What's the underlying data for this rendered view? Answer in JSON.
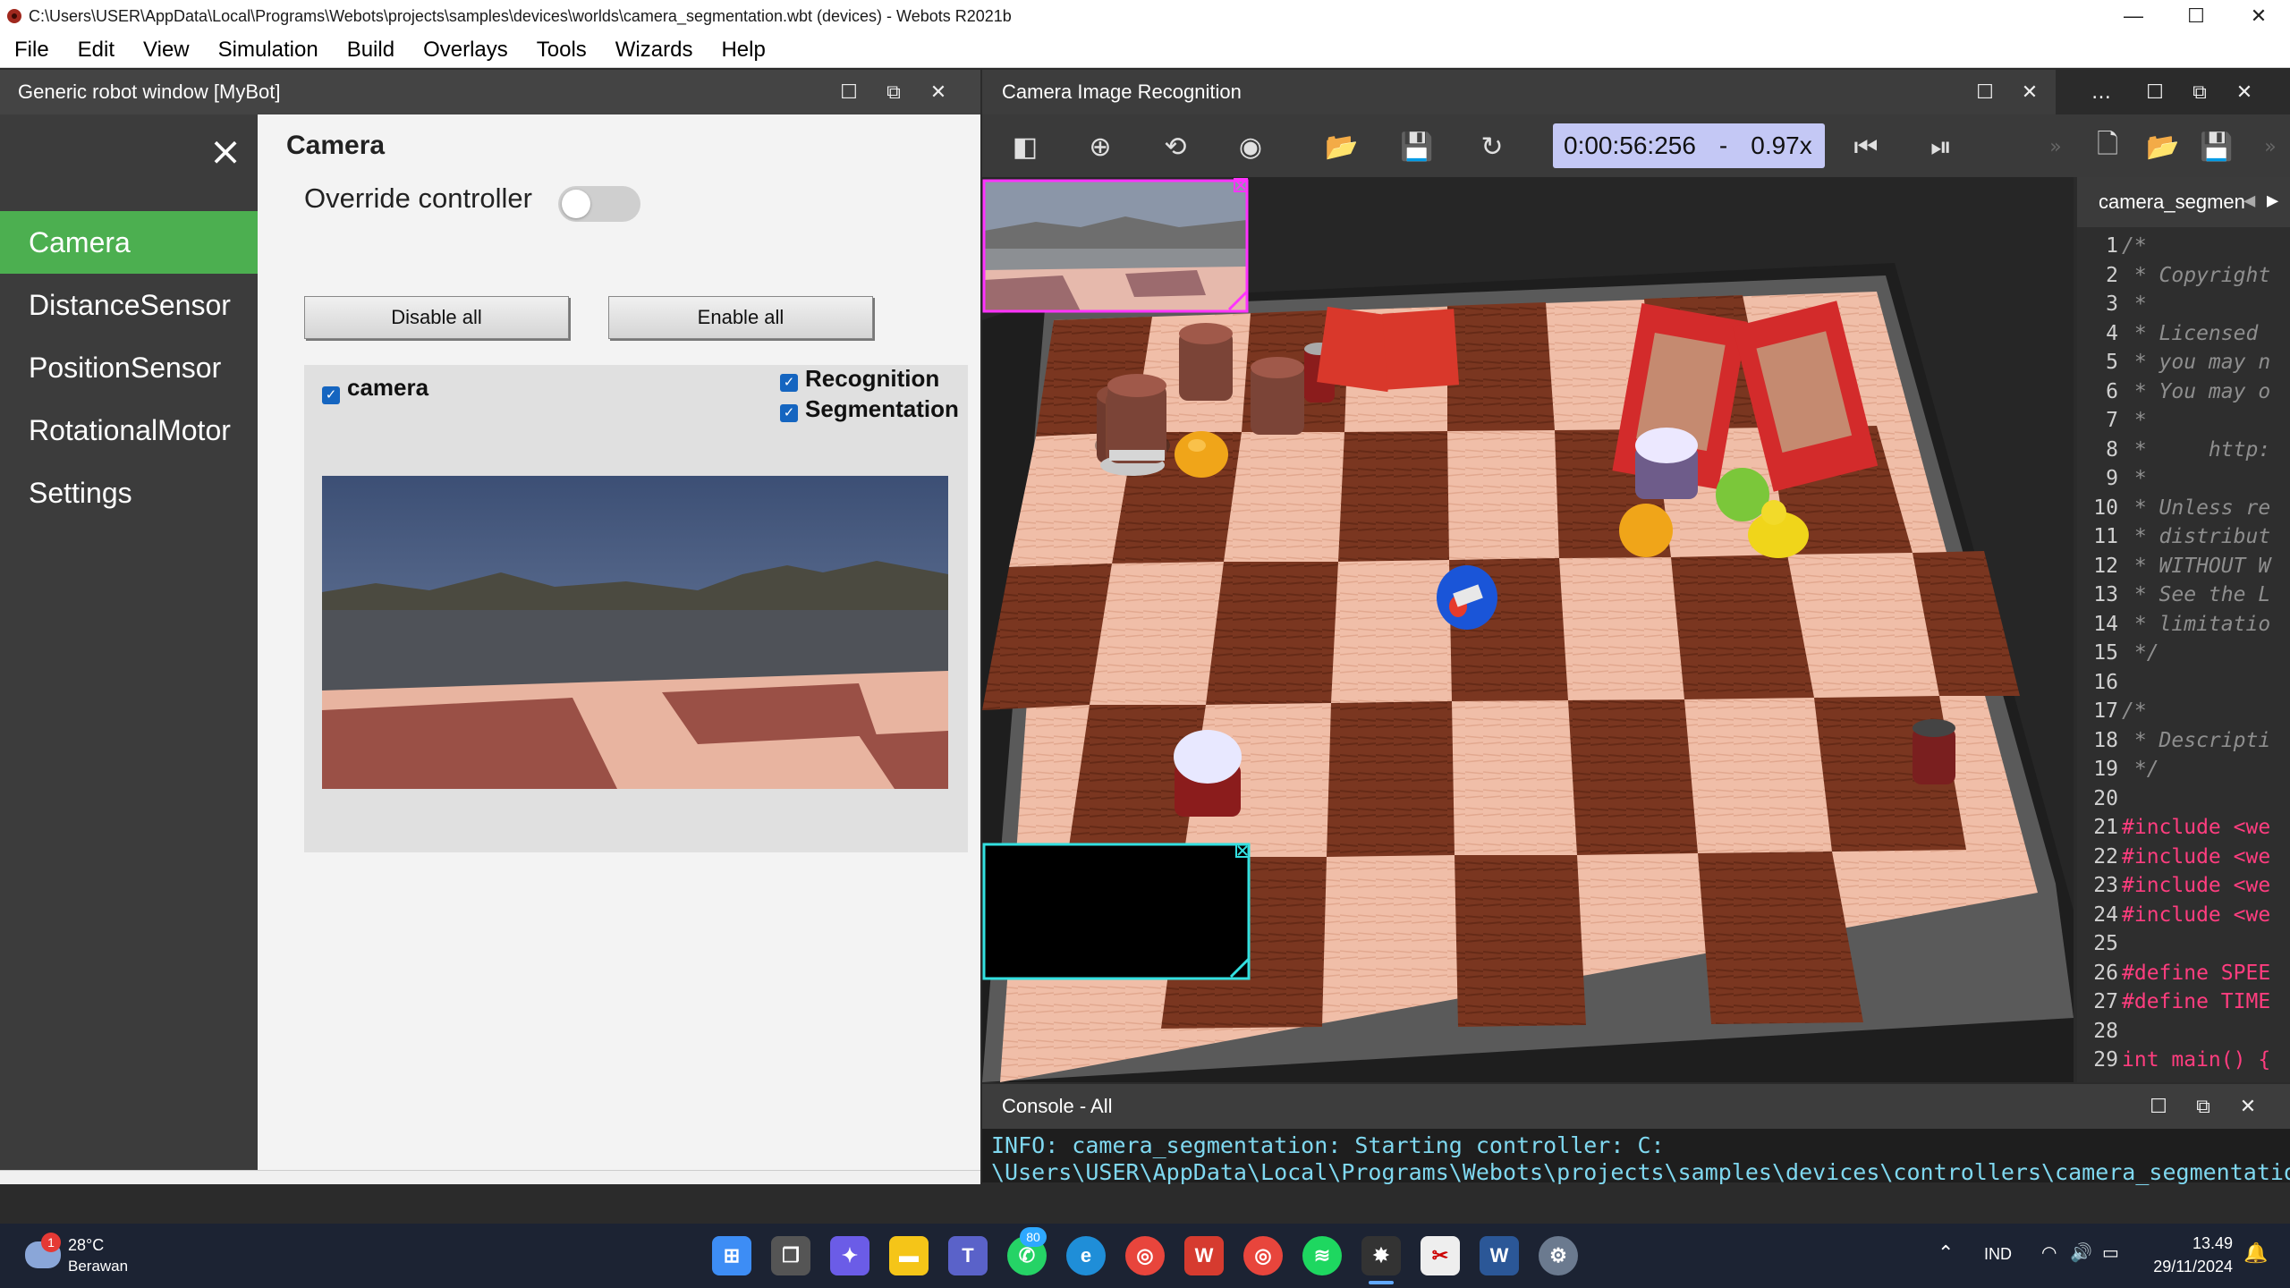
{
  "window": {
    "title": "C:\\Users\\USER\\AppData\\Local\\Programs\\Webots\\projects\\samples\\devices\\worlds\\camera_segmentation.wbt (devices) - Webots R2021b",
    "minimize": "—",
    "maximize": "☐",
    "close": "✕"
  },
  "menu": [
    "File",
    "Edit",
    "View",
    "Simulation",
    "Build",
    "Overlays",
    "Tools",
    "Wizards",
    "Help"
  ],
  "robot_window": {
    "title": "Generic robot window [MyBot]",
    "nav_items": [
      "Camera",
      "DistanceSensor",
      "PositionSensor",
      "RotationalMotor",
      "Settings"
    ],
    "active_index": 0,
    "heading": "Camera",
    "override_label": "Override controller",
    "override_on": false,
    "disable_all": "Disable all",
    "enable_all": "Enable all",
    "device_name": "camera",
    "recognition_label": "Recognition",
    "segmentation_label": "Segmentation"
  },
  "camera_overlay": {
    "title": "Camera Image Recognition"
  },
  "simulation": {
    "time": "0:00:56:256",
    "separator": "-",
    "speed": "0.97x"
  },
  "editor": {
    "tab": "camera_segmen",
    "lines": [
      {
        "n": "1",
        "t": "/*",
        "c": "cm"
      },
      {
        "n": "2",
        "t": " * Copyright",
        "c": "cm"
      },
      {
        "n": "3",
        "t": " *",
        "c": "cm"
      },
      {
        "n": "4",
        "t": " * Licensed",
        "c": "cm"
      },
      {
        "n": "5",
        "t": " * you may n",
        "c": "cm"
      },
      {
        "n": "6",
        "t": " * You may o",
        "c": "cm"
      },
      {
        "n": "7",
        "t": " *",
        "c": "cm"
      },
      {
        "n": "8",
        "t": " *     http:",
        "c": "cm"
      },
      {
        "n": "9",
        "t": " *",
        "c": "cm"
      },
      {
        "n": "10",
        "t": " * Unless re",
        "c": "cm"
      },
      {
        "n": "11",
        "t": " * distribut",
        "c": "cm"
      },
      {
        "n": "12",
        "t": " * WITHOUT W",
        "c": "cm"
      },
      {
        "n": "13",
        "t": " * See the L",
        "c": "cm"
      },
      {
        "n": "14",
        "t": " * limitatio",
        "c": "cm"
      },
      {
        "n": "15",
        "t": " */",
        "c": "cm"
      },
      {
        "n": "16",
        "t": "",
        "c": "tx"
      },
      {
        "n": "17",
        "t": "/*",
        "c": "cm"
      },
      {
        "n": "18",
        "t": " * Descripti",
        "c": "cm"
      },
      {
        "n": "19",
        "t": " */",
        "c": "cm"
      },
      {
        "n": "20",
        "t": "",
        "c": "tx"
      },
      {
        "n": "21",
        "t": "#include <we",
        "c": "pp"
      },
      {
        "n": "22",
        "t": "#include <we",
        "c": "pp"
      },
      {
        "n": "23",
        "t": "#include <we",
        "c": "pp"
      },
      {
        "n": "24",
        "t": "#include <we",
        "c": "pp"
      },
      {
        "n": "25",
        "t": "",
        "c": "tx"
      },
      {
        "n": "26",
        "t": "#define SPEE",
        "c": "pp"
      },
      {
        "n": "27",
        "t": "#define TIME",
        "c": "pp"
      },
      {
        "n": "28",
        "t": "",
        "c": "tx"
      },
      {
        "n": "29",
        "t": "int main() {",
        "c": "kw"
      }
    ]
  },
  "console": {
    "title": "Console - All",
    "lines": [
      "INFO: camera_segmentation: Starting controller: C:",
      "\\Users\\USER\\AppData\\Local\\Programs\\Webots\\projects\\samples\\devices\\controllers\\camera_segmentation\\"
    ]
  },
  "taskbar": {
    "weather_temp": "28°C",
    "weather_desc": "Berawan",
    "weather_badge": "1",
    "whatsapp_badge": "80",
    "lang": "IND",
    "time": "13.49",
    "date": "29/11/2024"
  }
}
